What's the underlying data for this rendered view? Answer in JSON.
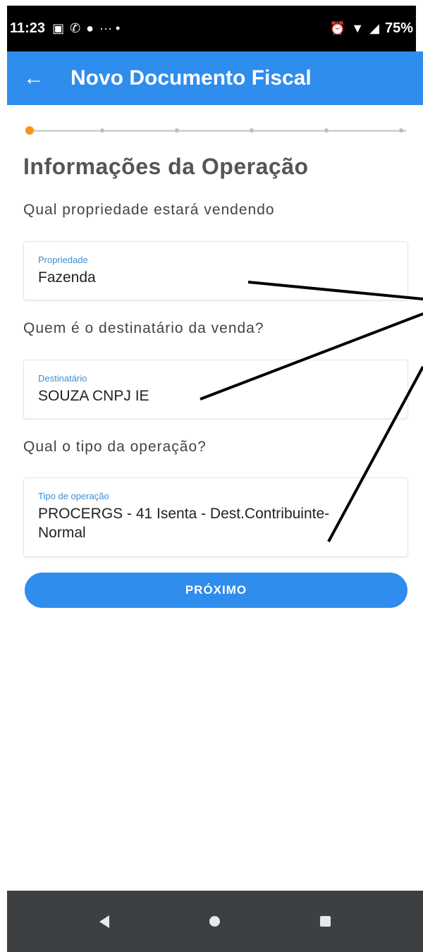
{
  "status_bar": {
    "time": "11:23",
    "battery": "75%"
  },
  "app_bar": {
    "title": "Novo Documento Fiscal",
    "back_icon": "arrow-left"
  },
  "form": {
    "section_title": "Informações da Operação",
    "property": {
      "question": "Qual propriedade estará vendendo",
      "label": "Propriedade",
      "value": "Fazenda"
    },
    "recipient": {
      "question": "Quem é o destinatário da venda?",
      "label": "Destinatário",
      "value": "SOUZA CNPJ IE"
    },
    "operation": {
      "question": "Qual o tipo da operação?",
      "label": "Tipo de operação",
      "value_line1": "PROCERGS - 41 Isenta - Dest.Contribuinte-",
      "value_line2": "Normal"
    },
    "next_button": "PRÓXIMO"
  },
  "colors": {
    "primary": "#2e8ded",
    "accent": "#f7941d",
    "nav_bar": "#3c4043"
  }
}
